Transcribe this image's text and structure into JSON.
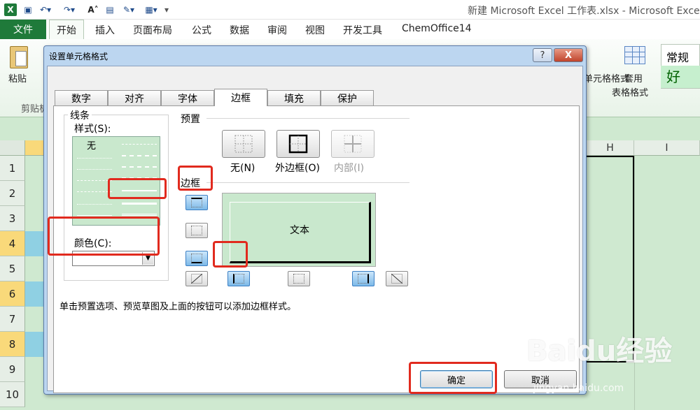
{
  "app": {
    "title": "新建 Microsoft Excel 工作表.xlsx - Microsoft Exce",
    "logo": "X",
    "qa_icons": [
      "save-icon",
      "undo-icon",
      "redo-icon",
      "font-size-icon",
      "format-icon",
      "highlight-icon",
      "table-icon",
      "customize-icon"
    ]
  },
  "ribbon": {
    "file_tab": "文件",
    "tabs": [
      "开始",
      "插入",
      "页面布局",
      "公式",
      "数据",
      "审阅",
      "视图",
      "开发工具",
      "ChemOffice14"
    ],
    "paste_label": "粘贴",
    "clipboard_label": "剪贴板",
    "cell_styles_label": "单元格格式",
    "table_format_line1": "套用",
    "table_format_line2": "表格格式",
    "style_normal": "常规",
    "style_good": "好",
    "colors": {
      "excel_green": "#1f7a3a",
      "good_fill": "#c6efce",
      "good_text": "#006100"
    }
  },
  "sheet": {
    "columns": [
      "H",
      "I"
    ],
    "rows": [
      "1",
      "2",
      "3",
      "4",
      "5",
      "6",
      "7",
      "8",
      "9",
      "10"
    ],
    "selected_rows": [
      "4",
      "6",
      "8"
    ]
  },
  "dialog": {
    "title": "设置单元格格式",
    "help": "?",
    "close": "X",
    "tabs": [
      "数字",
      "对齐",
      "字体",
      "边框",
      "填充",
      "保护"
    ],
    "active_tab": "边框",
    "line_group": "线条",
    "style_label": "样式(S):",
    "style_none": "无",
    "color_label": "颜色(C):",
    "preset_label": "预置",
    "presets": [
      {
        "label": "无(N)",
        "icon": "border-none-icon"
      },
      {
        "label": "外边框(O)",
        "icon": "border-outline-icon"
      },
      {
        "label": "内部(I)",
        "icon": "border-inside-icon"
      }
    ],
    "border_label": "边框",
    "preview_text": "文本",
    "hint": "单击预置选项、预览草图及上面的按钮可以添加边框样式。",
    "ok": "确定",
    "cancel": "取消"
  },
  "watermark": {
    "main": "Baidu经验",
    "sub": "jingyan.baidu.com"
  }
}
